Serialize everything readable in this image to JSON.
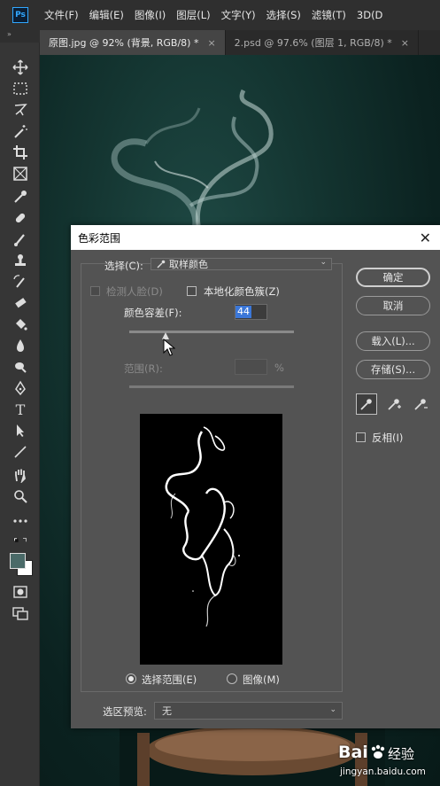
{
  "app": {
    "logo_text": "Ps"
  },
  "menu": [
    "文件(F)",
    "编辑(E)",
    "图像(I)",
    "图层(L)",
    "文字(Y)",
    "选择(S)",
    "滤镜(T)",
    "3D(D"
  ],
  "tabs": [
    {
      "label": "原图.jpg @ 92% (背景, RGB/8) *",
      "close": "×"
    },
    {
      "label": "2.psd @ 97.6% (图层 1, RGB/8) *",
      "close": "×"
    }
  ],
  "toolbar": {
    "collapse_glyph": "»"
  },
  "dialog": {
    "title": "色彩范围",
    "close": "✕",
    "select_label": "选择(C):",
    "select_value": "取样颜色",
    "detect_faces_label": "检测人脸(D)",
    "localized_label": "本地化颜色簇(Z)",
    "fuzziness_label": "颜色容差(F):",
    "fuzziness_value": "44",
    "fuzziness_level": 0.22,
    "range_label": "范围(R):",
    "range_unit": "%",
    "radio_selection": "选择范围(E)",
    "radio_image": "图像(M)",
    "preview_label": "选区预览:",
    "preview_value": "无",
    "buttons": {
      "ok": "确定",
      "cancel": "取消",
      "load": "载入(L)...",
      "save": "存储(S)..."
    },
    "invert_label": "反相(I)"
  },
  "watermark": {
    "logo": "Bai",
    "text": "经验",
    "url": "jingyan.baidu.com"
  },
  "colors": {
    "accent": "#3b77d8",
    "dialog_bg": "#535353",
    "title_bar": "#ffffff"
  }
}
